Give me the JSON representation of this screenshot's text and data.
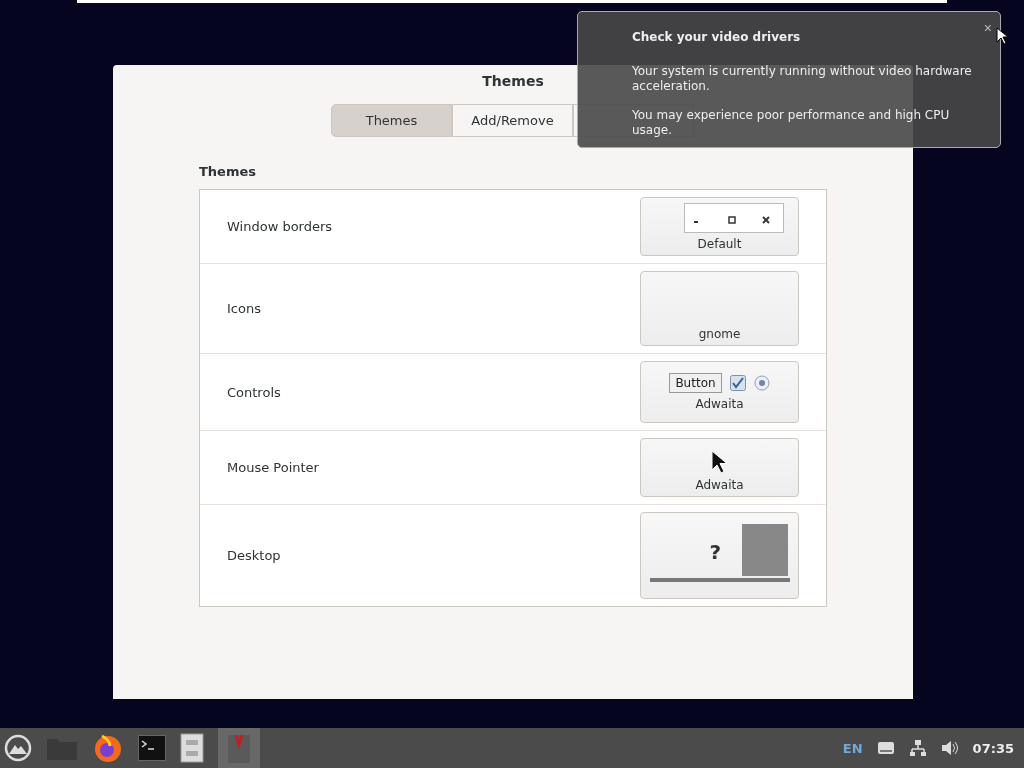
{
  "window": {
    "title": "Themes"
  },
  "tabs": [
    {
      "label": "Themes",
      "selected": true
    },
    {
      "label": "Add/Remove",
      "selected": false
    },
    {
      "selected": false
    }
  ],
  "section_title": "Themes",
  "rows": [
    {
      "label": "Window borders",
      "kind": "borders",
      "value": "Default"
    },
    {
      "label": "Icons",
      "kind": "icons",
      "value": "gnome"
    },
    {
      "label": "Controls",
      "kind": "controls",
      "value": "Adwaita",
      "sample_button": "Button"
    },
    {
      "label": "Mouse Pointer",
      "kind": "pointer",
      "value": "Adwaita"
    },
    {
      "label": "Desktop",
      "kind": "desktop",
      "sample_mark": "?"
    }
  ],
  "notification": {
    "title": "Check your video drivers",
    "paragraphs": [
      "Your system is currently running without video hardware acceleration.",
      "You may experience poor performance and high CPU usage."
    ],
    "close": "×"
  },
  "taskbar": {
    "language": "EN",
    "clock": "07:35"
  }
}
